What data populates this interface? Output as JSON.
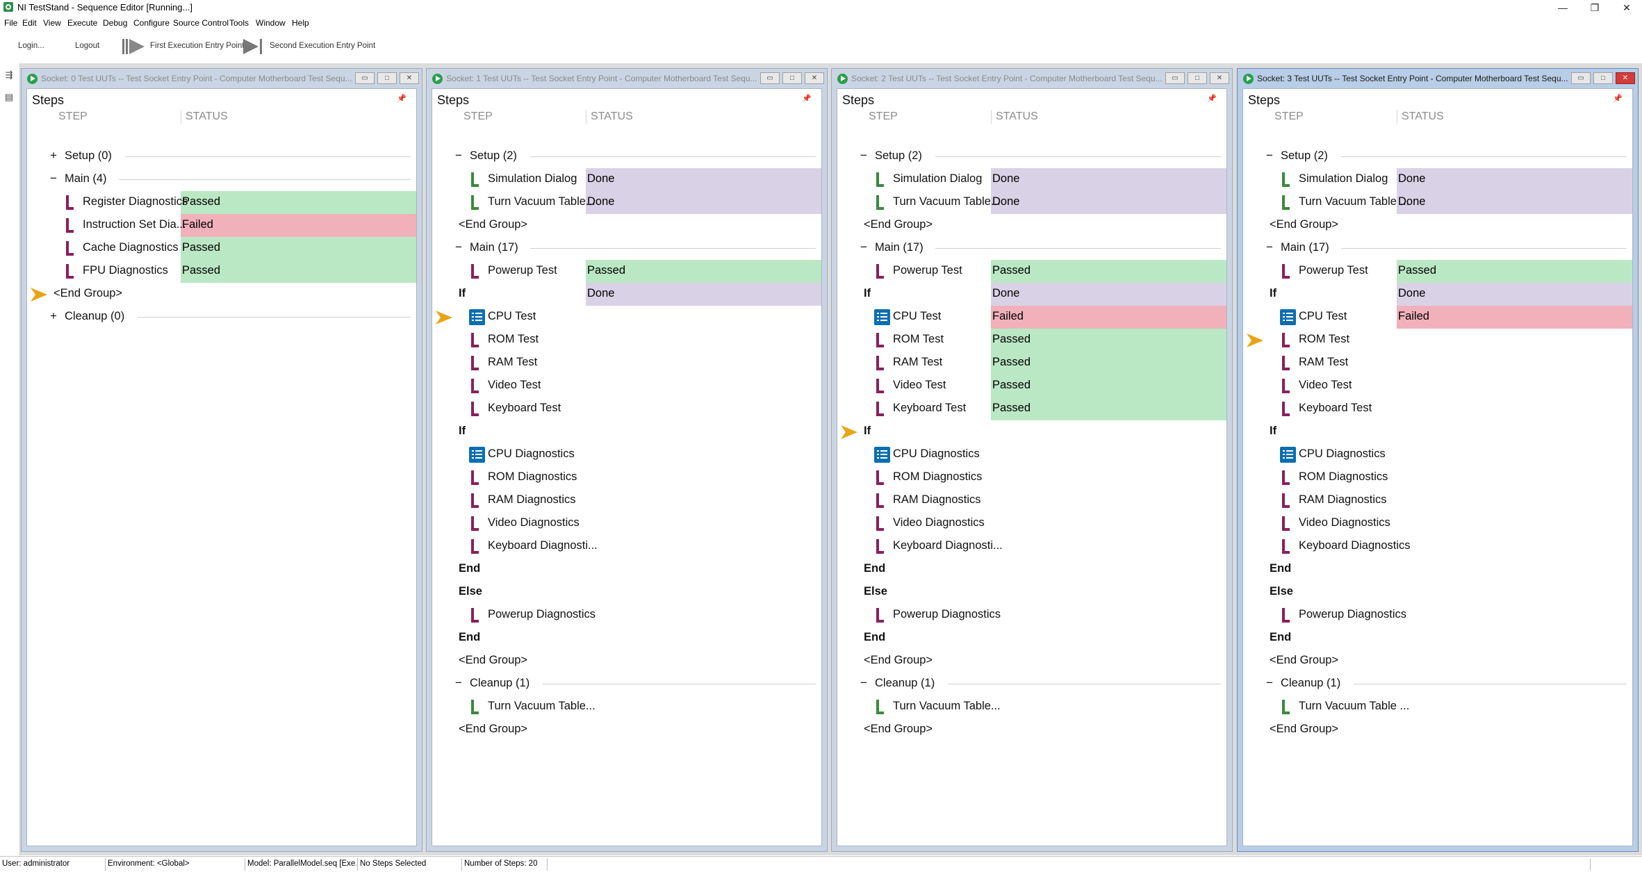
{
  "app": {
    "title": "NI TestStand - Sequence Editor [Running...]",
    "window_buttons": [
      "—",
      "❐",
      "✕"
    ]
  },
  "menu": [
    "File",
    "Edit",
    "View",
    "Execute",
    "Debug",
    "Configure",
    "Source Control",
    "Tools",
    "Window",
    "Help"
  ],
  "toolbar": {
    "login": "Login...",
    "logout": "Logout",
    "first_entry": "First Execution Entry Point",
    "second_entry": "Second Execution Entry Point"
  },
  "colors": {
    "passed": "#bbe8c4",
    "failed": "#f0b1bb",
    "done": "#d9d2e6",
    "arrow": "#e8a413"
  },
  "windows": [
    {
      "title": "Socket: 0  Test UUTs -- Test Socket Entry Point - Computer Motherboard Test Sequ...",
      "active": false,
      "steps_title": "Steps",
      "col_step": "STEP",
      "col_status": "STATUS",
      "rows": [
        {
          "type": "group",
          "toggle": "+",
          "indent": 1,
          "label": "Setup (0)"
        },
        {
          "type": "group",
          "toggle": "−",
          "indent": 1,
          "label": "Main (4)"
        },
        {
          "type": "step",
          "icon": "purple",
          "indent": 2,
          "label": "Register Diagnostics",
          "status": "Passed",
          "st": "passed"
        },
        {
          "type": "step",
          "icon": "purple",
          "indent": 2,
          "label": "Instruction Set Dia...",
          "status": "Failed",
          "st": "failed"
        },
        {
          "type": "step",
          "icon": "purple",
          "indent": 2,
          "label": "Cache Diagnostics",
          "status": "Passed",
          "st": "passed"
        },
        {
          "type": "step",
          "icon": "purple",
          "indent": 2,
          "label": "FPU Diagnostics",
          "status": "Passed",
          "st": "passed"
        },
        {
          "type": "text",
          "indent": 1,
          "label": "<End Group>",
          "arrow": true
        },
        {
          "type": "group",
          "toggle": "+",
          "indent": 1,
          "label": "Cleanup (0)"
        }
      ]
    },
    {
      "title": "Socket: 1  Test UUTs -- Test Socket Entry Point - Computer Motherboard Test Sequ...",
      "active": false,
      "steps_title": "Steps",
      "col_step": "STEP",
      "col_status": "STATUS",
      "rows": [
        {
          "type": "group",
          "toggle": "−",
          "indent": 1,
          "label": "Setup (2)"
        },
        {
          "type": "step",
          "icon": "green",
          "indent": 2,
          "label": "Simulation Dialog",
          "status": "Done",
          "st": "done"
        },
        {
          "type": "step",
          "icon": "green",
          "indent": 2,
          "label": "Turn Vacuum Table...",
          "status": "Done",
          "st": "done"
        },
        {
          "type": "text",
          "indent": 1,
          "label": "<End Group>"
        },
        {
          "type": "group",
          "toggle": "−",
          "indent": 1,
          "label": "Main (17)"
        },
        {
          "type": "step",
          "icon": "purple",
          "indent": 2,
          "label": "Powerup Test",
          "status": "Passed",
          "st": "passed"
        },
        {
          "type": "text",
          "indent": 1,
          "label": "If",
          "bold": true,
          "status": "Done",
          "st": "done"
        },
        {
          "type": "step",
          "icon": "list",
          "indent": 2,
          "label": "CPU Test",
          "arrow": true
        },
        {
          "type": "step",
          "icon": "purple",
          "indent": 2,
          "label": "ROM Test"
        },
        {
          "type": "step",
          "icon": "purple",
          "indent": 2,
          "label": "RAM Test"
        },
        {
          "type": "step",
          "icon": "purple",
          "indent": 2,
          "label": "Video Test"
        },
        {
          "type": "step",
          "icon": "purple",
          "indent": 2,
          "label": "Keyboard Test"
        },
        {
          "type": "text",
          "indent": 1,
          "label": "If",
          "bold": true
        },
        {
          "type": "step",
          "icon": "list",
          "indent": 2,
          "label": "CPU Diagnostics"
        },
        {
          "type": "step",
          "icon": "purple",
          "indent": 2,
          "label": "ROM Diagnostics"
        },
        {
          "type": "step",
          "icon": "purple",
          "indent": 2,
          "label": "RAM Diagnostics"
        },
        {
          "type": "step",
          "icon": "purple",
          "indent": 2,
          "label": "Video Diagnostics"
        },
        {
          "type": "step",
          "icon": "purple",
          "indent": 2,
          "label": "Keyboard Diagnosti..."
        },
        {
          "type": "text",
          "indent": 1,
          "label": "End",
          "bold": true
        },
        {
          "type": "text",
          "indent": 1,
          "label": "Else",
          "bold": true
        },
        {
          "type": "step",
          "icon": "purple",
          "indent": 2,
          "label": "Powerup Diagnostics"
        },
        {
          "type": "text",
          "indent": 1,
          "label": "End",
          "bold": true
        },
        {
          "type": "text",
          "indent": 1,
          "label": "<End Group>"
        },
        {
          "type": "group",
          "toggle": "−",
          "indent": 1,
          "label": "Cleanup (1)"
        },
        {
          "type": "step",
          "icon": "green",
          "indent": 2,
          "label": "Turn Vacuum Table..."
        },
        {
          "type": "text",
          "indent": 1,
          "label": "<End Group>"
        }
      ]
    },
    {
      "title": "Socket: 2  Test UUTs -- Test Socket Entry Point - Computer Motherboard Test Sequ...",
      "active": false,
      "steps_title": "Steps",
      "col_step": "STEP",
      "col_status": "STATUS",
      "rows": [
        {
          "type": "group",
          "toggle": "−",
          "indent": 1,
          "label": "Setup (2)"
        },
        {
          "type": "step",
          "icon": "green",
          "indent": 2,
          "label": "Simulation Dialog",
          "status": "Done",
          "st": "done"
        },
        {
          "type": "step",
          "icon": "green",
          "indent": 2,
          "label": "Turn Vacuum Table...",
          "status": "Done",
          "st": "done"
        },
        {
          "type": "text",
          "indent": 1,
          "label": "<End Group>"
        },
        {
          "type": "group",
          "toggle": "−",
          "indent": 1,
          "label": "Main (17)"
        },
        {
          "type": "step",
          "icon": "purple",
          "indent": 2,
          "label": "Powerup Test",
          "status": "Passed",
          "st": "passed"
        },
        {
          "type": "text",
          "indent": 1,
          "label": "If",
          "bold": true,
          "status": "Done",
          "st": "done"
        },
        {
          "type": "step",
          "icon": "list",
          "indent": 2,
          "label": "CPU Test",
          "status": "Failed",
          "st": "failed"
        },
        {
          "type": "step",
          "icon": "purple",
          "indent": 2,
          "label": "ROM Test",
          "status": "Passed",
          "st": "passed"
        },
        {
          "type": "step",
          "icon": "purple",
          "indent": 2,
          "label": "RAM Test",
          "status": "Passed",
          "st": "passed"
        },
        {
          "type": "step",
          "icon": "purple",
          "indent": 2,
          "label": "Video Test",
          "status": "Passed",
          "st": "passed"
        },
        {
          "type": "step",
          "icon": "purple",
          "indent": 2,
          "label": "Keyboard Test",
          "status": "Passed",
          "st": "passed"
        },
        {
          "type": "text",
          "indent": 1,
          "label": "If",
          "bold": true,
          "arrow": true
        },
        {
          "type": "step",
          "icon": "list",
          "indent": 2,
          "label": "CPU Diagnostics"
        },
        {
          "type": "step",
          "icon": "purple",
          "indent": 2,
          "label": "ROM Diagnostics"
        },
        {
          "type": "step",
          "icon": "purple",
          "indent": 2,
          "label": "RAM Diagnostics"
        },
        {
          "type": "step",
          "icon": "purple",
          "indent": 2,
          "label": "Video Diagnostics"
        },
        {
          "type": "step",
          "icon": "purple",
          "indent": 2,
          "label": "Keyboard Diagnosti..."
        },
        {
          "type": "text",
          "indent": 1,
          "label": "End",
          "bold": true
        },
        {
          "type": "text",
          "indent": 1,
          "label": "Else",
          "bold": true
        },
        {
          "type": "step",
          "icon": "purple",
          "indent": 2,
          "label": "Powerup Diagnostics"
        },
        {
          "type": "text",
          "indent": 1,
          "label": "End",
          "bold": true
        },
        {
          "type": "text",
          "indent": 1,
          "label": "<End Group>"
        },
        {
          "type": "group",
          "toggle": "−",
          "indent": 1,
          "label": "Cleanup (1)"
        },
        {
          "type": "step",
          "icon": "green",
          "indent": 2,
          "label": "Turn Vacuum Table..."
        },
        {
          "type": "text",
          "indent": 1,
          "label": "<End Group>"
        }
      ]
    },
    {
      "title": "Socket: 3  Test UUTs -- Test Socket Entry Point - Computer Motherboard Test Sequ...",
      "active": true,
      "steps_title": "Steps",
      "col_step": "STEP",
      "col_status": "STATUS",
      "rows": [
        {
          "type": "group",
          "toggle": "−",
          "indent": 1,
          "label": "Setup (2)"
        },
        {
          "type": "step",
          "icon": "green",
          "indent": 2,
          "label": "Simulation Dialog",
          "status": "Done",
          "st": "done"
        },
        {
          "type": "step",
          "icon": "green",
          "indent": 2,
          "label": "Turn Vacuum Table ...",
          "status": "Done",
          "st": "done"
        },
        {
          "type": "text",
          "indent": 1,
          "label": "<End Group>"
        },
        {
          "type": "group",
          "toggle": "−",
          "indent": 1,
          "label": "Main (17)"
        },
        {
          "type": "step",
          "icon": "purple",
          "indent": 2,
          "label": "Powerup Test",
          "status": "Passed",
          "st": "passed"
        },
        {
          "type": "text",
          "indent": 1,
          "label": "If",
          "bold": true,
          "status": "Done",
          "st": "done"
        },
        {
          "type": "step",
          "icon": "list",
          "indent": 2,
          "label": "CPU Test",
          "status": "Failed",
          "st": "failed"
        },
        {
          "type": "step",
          "icon": "purple",
          "indent": 2,
          "label": "ROM Test",
          "arrow": true
        },
        {
          "type": "step",
          "icon": "purple",
          "indent": 2,
          "label": "RAM Test"
        },
        {
          "type": "step",
          "icon": "purple",
          "indent": 2,
          "label": "Video Test"
        },
        {
          "type": "step",
          "icon": "purple",
          "indent": 2,
          "label": "Keyboard Test"
        },
        {
          "type": "text",
          "indent": 1,
          "label": "If",
          "bold": true
        },
        {
          "type": "step",
          "icon": "list",
          "indent": 2,
          "label": "CPU Diagnostics"
        },
        {
          "type": "step",
          "icon": "purple",
          "indent": 2,
          "label": "ROM Diagnostics"
        },
        {
          "type": "step",
          "icon": "purple",
          "indent": 2,
          "label": "RAM Diagnostics"
        },
        {
          "type": "step",
          "icon": "purple",
          "indent": 2,
          "label": "Video Diagnostics"
        },
        {
          "type": "step",
          "icon": "purple",
          "indent": 2,
          "label": "Keyboard Diagnostics"
        },
        {
          "type": "text",
          "indent": 1,
          "label": "End",
          "bold": true
        },
        {
          "type": "text",
          "indent": 1,
          "label": "Else",
          "bold": true
        },
        {
          "type": "step",
          "icon": "purple",
          "indent": 2,
          "label": "Powerup Diagnostics"
        },
        {
          "type": "text",
          "indent": 1,
          "label": "End",
          "bold": true
        },
        {
          "type": "text",
          "indent": 1,
          "label": "<End Group>"
        },
        {
          "type": "group",
          "toggle": "−",
          "indent": 1,
          "label": "Cleanup (1)"
        },
        {
          "type": "step",
          "icon": "green",
          "indent": 2,
          "label": "Turn Vacuum Table ..."
        },
        {
          "type": "text",
          "indent": 1,
          "label": "<End Group>"
        }
      ]
    }
  ],
  "statusbar": {
    "user": "User: administrator",
    "environment": "Environment: <Global>",
    "model": "Model: ParallelModel.seq [Exe...",
    "selection": "No Steps Selected",
    "count": "Number of Steps: 20"
  }
}
